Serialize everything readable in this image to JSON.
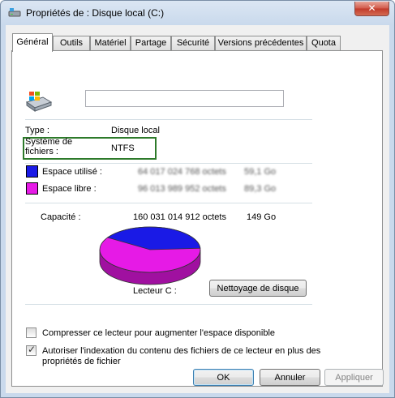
{
  "window": {
    "title": "Propriétés de : Disque local (C:)",
    "close_glyph": "✕"
  },
  "tabs": [
    {
      "label": "Général",
      "active": true
    },
    {
      "label": "Outils"
    },
    {
      "label": "Matériel"
    },
    {
      "label": "Partage"
    },
    {
      "label": "Sécurité"
    },
    {
      "label": "Versions précédentes"
    },
    {
      "label": "Quota"
    }
  ],
  "general": {
    "name_value": "",
    "type_label": "Type :",
    "type_value": "Disque local",
    "fs_label_line1": "Système de",
    "fs_label_line2": "fichiers :",
    "fs_value": "NTFS",
    "used_label": "Espace utilisé :",
    "used_bytes": "64 017 024 768 octets",
    "used_gb": "59,1 Go",
    "free_label": "Espace libre :",
    "free_bytes": "96 013 989 952 octets",
    "free_gb": "89,3 Go",
    "capacity_label": "Capacité :",
    "capacity_bytes": "160 031 014 912 octets",
    "capacity_gb": "149 Go",
    "drive_label": "Lecteur C :",
    "cleanup_button": "Nettoyage de disque",
    "compress_label": "Compresser ce lecteur pour augmenter l'espace disponible",
    "compress_checked": false,
    "index_label_line1": "Autoriser l'indexation du contenu des fichiers de ce lecteur en plus des",
    "index_label_line2": "propriétés de fichier",
    "index_checked": true
  },
  "buttons": {
    "ok": "OK",
    "cancel": "Annuler",
    "apply": "Appliquer"
  },
  "pie": {
    "used_fraction": 0.4,
    "used_color": "#1a1ae6",
    "free_color": "#e61ae6"
  },
  "colors": {
    "used": "#1a1ae6",
    "free": "#e61ae6",
    "highlight": "#2d7a2a"
  }
}
